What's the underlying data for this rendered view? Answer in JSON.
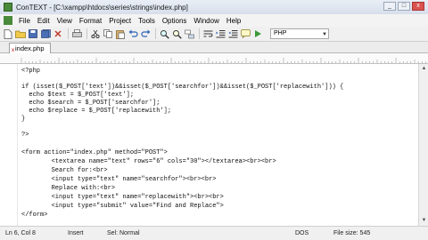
{
  "window": {
    "title": "ConTEXT - [C:\\xampp\\htdocs\\series\\strings\\index.php]",
    "buttons": [
      "_",
      "□",
      "x"
    ]
  },
  "menu": {
    "items": [
      "File",
      "Edit",
      "View",
      "Format",
      "Project",
      "Tools",
      "Options",
      "Window",
      "Help"
    ]
  },
  "toolbar": {
    "language": "PHP"
  },
  "tabs": [
    {
      "label": "index.php",
      "close": "x"
    }
  ],
  "editor": {
    "lines": [
      "<?php",
      "",
      "if (isset($_POST['text'])&&isset($_POST['searchfor'])&&isset($_POST['replacewith'])) {",
      "  echo $text = $_POST['text'];",
      "  echo $search = $_POST['searchfor'];",
      "  echo $replace = $_POST['replacewith'];",
      "}",
      "",
      "?>",
      "",
      "<form action=\"index.php\" method=\"POST\">",
      "        <textarea name=\"text\" rows=\"6\" cols=\"30\"></textarea><br><br>",
      "        Search for:<br>",
      "        <input type=\"text\" name=\"searchfor\"><br><br>",
      "        Replace with:<br>",
      "        <input type=\"text\" name=\"replacewith\"><br><br>",
      "        <input type=\"submit\" value=\"Find and Replace\">",
      "</form>"
    ]
  },
  "status": {
    "position": "Ln 6, Col 8",
    "mode": "Insert",
    "selection": "Sel: Normal",
    "line_endings": "DOS",
    "file_size": "File size: 545"
  }
}
